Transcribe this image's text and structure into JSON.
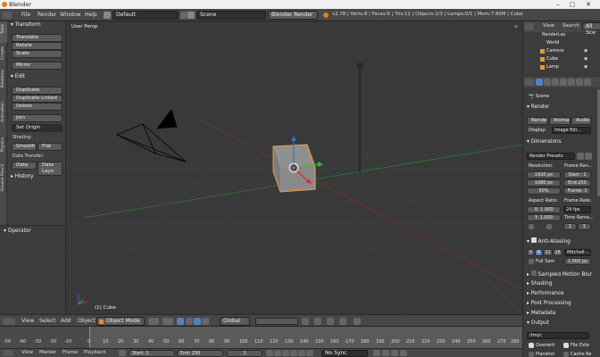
{
  "window": {
    "title": "Blender",
    "minimize": "–",
    "maximize": "▢",
    "close": "✕"
  },
  "infobar": {
    "menus": [
      "File",
      "Render",
      "Window",
      "Help"
    ],
    "layout": "Default",
    "scene": "Scene",
    "engine": "Blender Render",
    "stats": "v2.78 | Verts:8 | Faces:6 | Tris:12 | Objects:1/3 | Lamps:0/1 | Mem:7.80M | Cube"
  },
  "toolshelf": {
    "tabs": [
      "Tools",
      "Create",
      "Relations",
      "Animation",
      "Physics",
      "Grease Pencil"
    ],
    "transform": {
      "title": "Transform",
      "buttons": [
        "Translate",
        "Rotate",
        "Scale",
        "Mirror"
      ]
    },
    "edit": {
      "title": "Edit",
      "buttons": [
        "Duplicate",
        "Duplicate Linked",
        "Delete",
        "Join"
      ],
      "set_origin": "Set Origin"
    },
    "shading": {
      "label": "Shading:",
      "smooth": "Smooth",
      "flat": "Flat"
    },
    "data_transfer": {
      "label": "Data Transfer:",
      "data": "Data",
      "data_layout": "Data Layo"
    },
    "history": "History",
    "operator": "Operator"
  },
  "viewport": {
    "label": "User Persp",
    "object": "(1) Cube"
  },
  "view_header": {
    "menus": [
      "View",
      "Select",
      "Add",
      "Object"
    ],
    "mode": "Object Mode",
    "pivot": "Global"
  },
  "timeline": {
    "ticks": [
      "-50",
      "-40",
      "-30",
      "-20",
      "-10",
      "0",
      "10",
      "20",
      "30",
      "40",
      "50",
      "60",
      "70",
      "80",
      "90",
      "100",
      "110",
      "120",
      "130",
      "140",
      "150",
      "160",
      "170",
      "180",
      "190",
      "200",
      "210",
      "220",
      "230",
      "240",
      "250",
      "260",
      "270",
      "280"
    ],
    "menus": [
      "View",
      "Marker",
      "Frame",
      "Playback"
    ],
    "start_label": "Start:",
    "start": "1",
    "end_label": "End:",
    "end": "250",
    "current": "1",
    "sync": "No Sync"
  },
  "outliner": {
    "header": {
      "view": "View",
      "search": "Search",
      "all_scenes": "All Sce"
    },
    "items": [
      "RenderLay",
      "World",
      "Camera",
      "Cube",
      "Lamp"
    ]
  },
  "properties": {
    "scene": "Scene",
    "render": {
      "title": "Render",
      "render_btn": "Rende",
      "anim_btn": "Anima",
      "audio_btn": "Audio",
      "display_label": "Display:",
      "display_value": "Image Edi..."
    },
    "dimensions": {
      "title": "Dimensions",
      "presets": "Render Presets",
      "resolution_label": "Resolution:",
      "res_x": "1920 px",
      "res_y": "1080 px",
      "res_pct": "50%",
      "frame_range_label": "Frame Ran...",
      "start": "Start : 1",
      "end": "End:250",
      "frame_step": "Frame: 1",
      "aspect_label": "Aspect Ratio:",
      "aspect_x": "X: 1.000",
      "aspect_y": "Y: 1.000",
      "frame_rate_label": "Frame Rate:",
      "fps": "24 fps",
      "time_remap_label": "Time Rema...",
      "remap_old": "1",
      "remap_new": "1"
    },
    "aa": {
      "title": "Anti-Aliasing",
      "samples": [
        "5",
        "8",
        "11",
        "16"
      ],
      "filter": "Mitchell-...",
      "full_sample": "Full Sam",
      "size": "1.000 px"
    },
    "panels": [
      "Sampled Motion Blur",
      "Shading",
      "Performance",
      "Post Processing",
      "Metadata",
      "Output"
    ],
    "output": {
      "path": "/tmp\\",
      "overwrite": "Overwrit",
      "file_ext": "File Exte",
      "placeholders": "Placehol",
      "cache_result": "Cache Re"
    }
  },
  "colors": {
    "bg": "#393939",
    "grid": "#4a4a4a",
    "x_axis": "#8a2e2e",
    "y_axis": "#6aa028",
    "selected": "#f0a040",
    "playhead": "#56c03c"
  }
}
